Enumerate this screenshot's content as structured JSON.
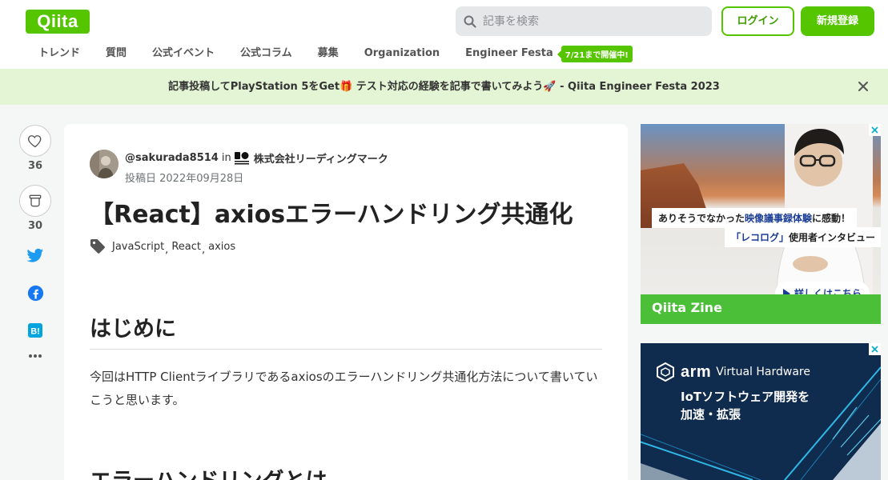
{
  "brand": {
    "logo_text": "Qiita",
    "accent": "#55c500"
  },
  "header": {
    "search_placeholder": "記事を検索",
    "login_label": "ログイン",
    "signup_label": "新規登録"
  },
  "nav": {
    "items": [
      "トレンド",
      "質問",
      "公式イベント",
      "公式コラム",
      "募集",
      "Organization",
      "Engineer Festa"
    ],
    "badge": "7/21まで開催中!"
  },
  "banner": {
    "text": "記事投稿してPlayStation 5をGet🎁 テスト対応の経験を記事で書いてみよう🚀 - Qiita Engineer Festa 2023"
  },
  "rail": {
    "like_count": "36",
    "stock_count": "30"
  },
  "article": {
    "author": "@sakurada8514",
    "in_text": "in",
    "organization": "株式会社リーディングマーク",
    "posted": "投稿日 2022年09月28日",
    "title": "【React】axiosエラーハンドリング共通化",
    "tags": [
      "JavaScript",
      "React",
      "axios"
    ],
    "tag_separator": ",",
    "heading1": "はじめに",
    "paragraph": "今回はHTTP Clientライブラリであるaxiosのエラーハンドリング共通化方法について書いていこうと思います。",
    "heading2": "エラーハンドリングとは"
  },
  "ads": {
    "ad1": {
      "caption1_pre": "ありそうでなかった",
      "caption1_em": "映像議事録体験",
      "caption1_post": "に感動！",
      "caption2_em": "「レコログ」",
      "caption2_post": "使用者インタビュー",
      "more": "詳しくはこちら",
      "footer": "Qiita Zine"
    },
    "ad2": {
      "brand": "arm",
      "product": "Virtual Hardware",
      "copy_line1": "IoTソフトウェア開発を",
      "copy_line2": "加速・拡張"
    }
  }
}
